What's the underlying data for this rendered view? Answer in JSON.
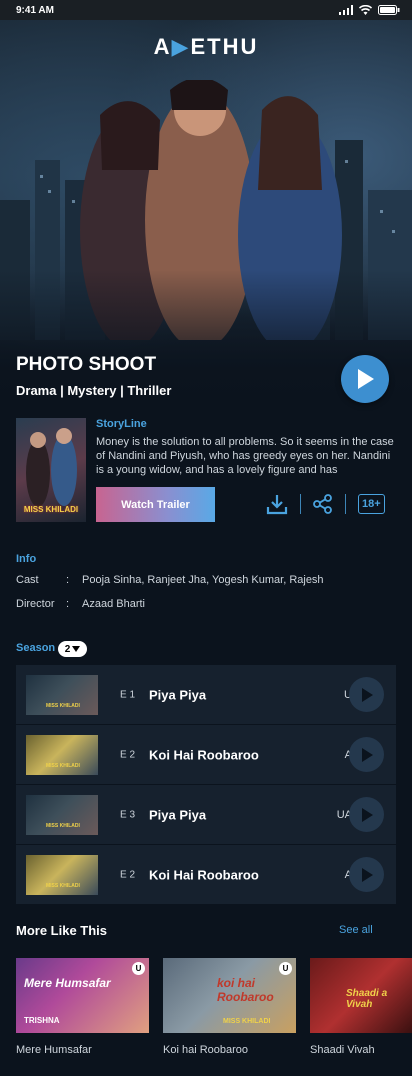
{
  "status_bar": {
    "time": "9:41 AM"
  },
  "app": {
    "logo_prefix": "A",
    "logo_mark": "▶",
    "logo_suffix": "ETHU"
  },
  "hero": {
    "title": "PHOTO SHOOT",
    "genres": "Drama | Mystery | Thriller"
  },
  "poster": {
    "text": "MISS KHILADI"
  },
  "storyline": {
    "label": "StoryLine",
    "text": "Money is the solution to all problems. So it seems in the case of Nandini and Piyush, who has greedy eyes on her. Nandini is a young widow, and has a lovely figure and has"
  },
  "actions": {
    "watch_trailer": "Watch Trailer",
    "rating": "18+"
  },
  "info": {
    "label": "Info",
    "cast_key": "Cast",
    "cast_value": "Pooja Sinha, Ranjeet Jha, Yogesh Kumar, Rajesh",
    "director_key": "Director",
    "director_value": "Azaad Bharti",
    "colon": ":"
  },
  "season": {
    "label": "Season",
    "selected": "2"
  },
  "episodes": [
    {
      "code": "E 1",
      "title": "Piya Piya",
      "rating": "U"
    },
    {
      "code": "E 2",
      "title": "Koi Hai Roobaroo",
      "rating": "A"
    },
    {
      "code": "E 3",
      "title": "Piya Piya",
      "rating": "UA"
    },
    {
      "code": "E 2",
      "title": "Koi Hai Roobaroo",
      "rating": "A"
    }
  ],
  "episode_thumb_text": "MISS KHILADI",
  "more_like_this": {
    "title": "More Like This",
    "see_all": "See all",
    "items": [
      {
        "name": "Mere Humsafar",
        "art_text": "Mere Humsafar",
        "art_sub": "TRISHNA",
        "badge": "U"
      },
      {
        "name": "Koi hai Roobaroo",
        "art_text": "koi hai Roobaroo",
        "art_sub": "MISS KHILADI",
        "badge": "U"
      },
      {
        "name": "Shaadi Vivah",
        "art_text": "Shaadi a Vivah",
        "art_sub": "",
        "badge": ""
      }
    ]
  },
  "colors": {
    "accent": "#4aa3df",
    "background": "#0b131d",
    "row": "#16212e"
  }
}
